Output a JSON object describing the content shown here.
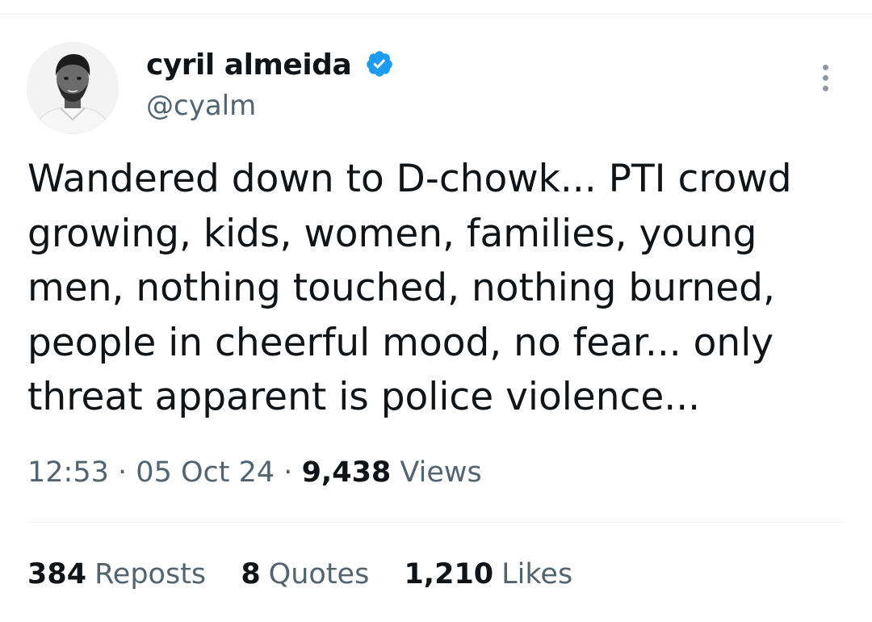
{
  "author": {
    "display_name": "cyril almeida",
    "handle": "@cyalm",
    "verified_icon": "verified-badge-icon",
    "avatar_icon": "avatar-photo"
  },
  "tweet": {
    "lines": [
      "Wandered down to D-chowk... PTI crowd",
      "growing, kids, women, families, young",
      "men, nothing touched, nothing burned,",
      "people in cheerful mood, no fear... only",
      "threat apparent is police violence..."
    ]
  },
  "meta": {
    "time": "12:53",
    "separator": "·",
    "date": "05 Oct 24",
    "views_count": "9,438",
    "views_label": "Views"
  },
  "stats": {
    "reposts_count": "384",
    "reposts_label": "Reposts",
    "quotes_count": "8",
    "quotes_label": "Quotes",
    "likes_count": "1,210",
    "likes_label": "Likes"
  },
  "colors": {
    "verified": "#1d9bf0",
    "text_primary": "#0f1419",
    "text_secondary": "#536471"
  }
}
